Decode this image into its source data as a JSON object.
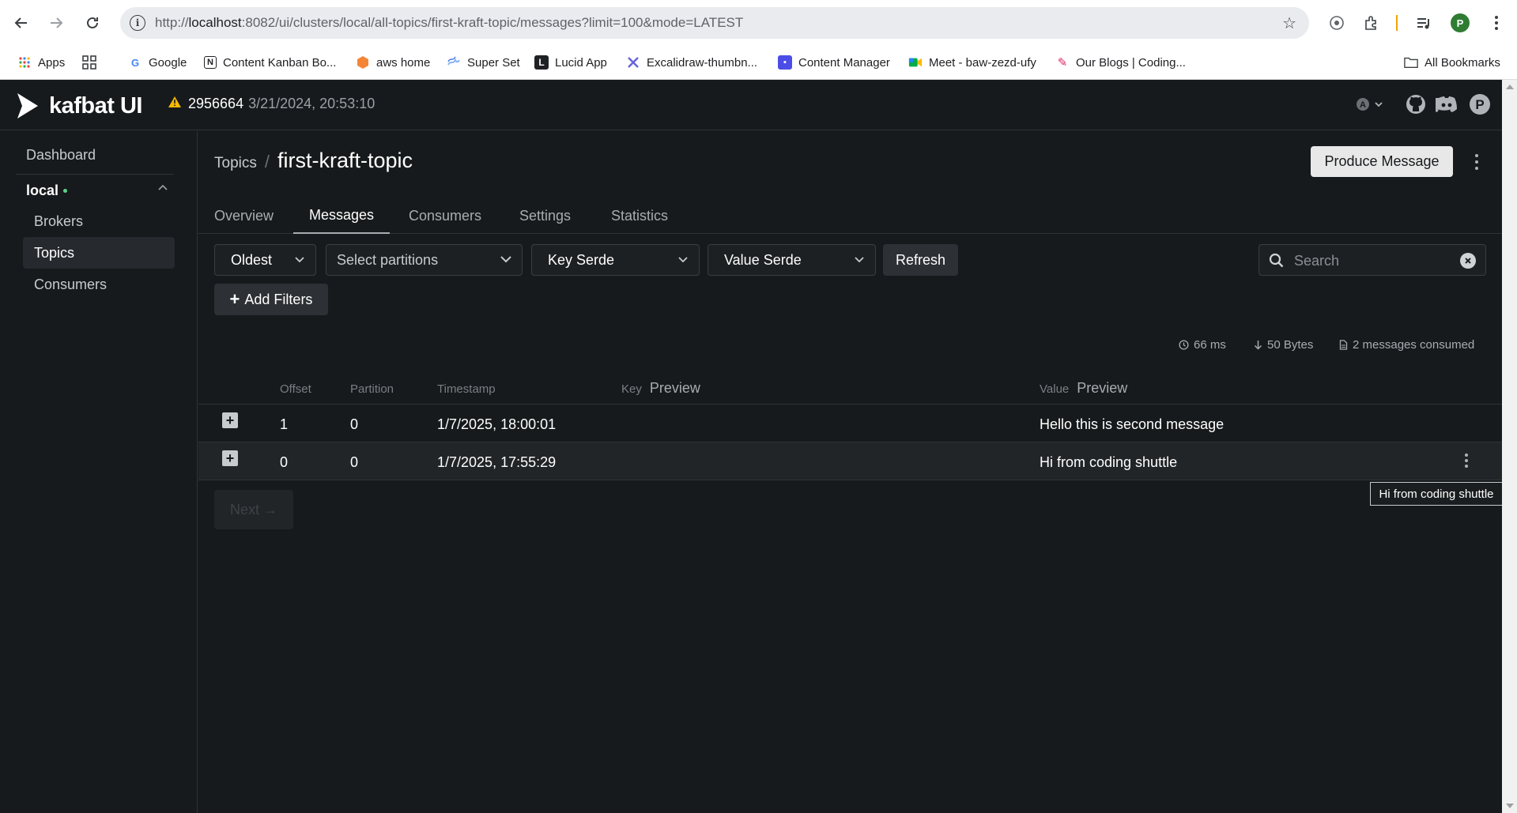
{
  "browser": {
    "url_prefix": "http://",
    "url_host": "localhost",
    "url_rest": ":8082/ui/clusters/local/all-topics/first-kraft-topic/messages?limit=100&mode=LATEST",
    "profile_initial": "P",
    "bookmarks": [
      {
        "label": "Apps",
        "icon": "apps-grid-icon"
      },
      {
        "label": "Google",
        "icon": "google-icon"
      },
      {
        "label": "Content Kanban Bo...",
        "icon": "notion-icon"
      },
      {
        "label": "aws home",
        "icon": "aws-icon"
      },
      {
        "label": "Super Set",
        "icon": "superset-icon"
      },
      {
        "label": "Lucid App",
        "icon": "lucid-icon"
      },
      {
        "label": "Excalidraw-thumbn...",
        "icon": "excalidraw-icon"
      },
      {
        "label": "Content Manager",
        "icon": "content-manager-icon"
      },
      {
        "label": "Meet - baw-zezd-ufy",
        "icon": "meet-icon"
      },
      {
        "label": "Our Blogs | Coding...",
        "icon": "blog-icon"
      }
    ],
    "all_bookmarks": "All Bookmarks"
  },
  "app": {
    "logo_text": "kafbat UI",
    "version": "2956664",
    "version_date": "3/21/2024, 20:53:10",
    "user_initial": "P"
  },
  "sidebar": {
    "dashboard": "Dashboard",
    "cluster": "local",
    "items": [
      {
        "label": "Brokers",
        "active": false
      },
      {
        "label": "Topics",
        "active": true
      },
      {
        "label": "Consumers",
        "active": false
      }
    ]
  },
  "breadcrumb": {
    "parent": "Topics",
    "separator": "/",
    "title": "first-kraft-topic"
  },
  "actions": {
    "produce": "Produce Message"
  },
  "tabs": [
    {
      "label": "Overview",
      "active": false
    },
    {
      "label": "Messages",
      "active": true
    },
    {
      "label": "Consumers",
      "active": false
    },
    {
      "label": "Settings",
      "active": false
    },
    {
      "label": "Statistics",
      "active": false
    }
  ],
  "filters": {
    "mode": "Oldest",
    "partitions_placeholder": "Select partitions",
    "key_serde": "Key Serde",
    "value_serde": "Value Serde",
    "refresh": "Refresh",
    "search_placeholder": "Search",
    "add_filters": "Add Filters"
  },
  "stats": {
    "elapsed": "66 ms",
    "bytes": "50 Bytes",
    "consumed": "2 messages consumed"
  },
  "table": {
    "headers": {
      "offset": "Offset",
      "partition": "Partition",
      "timestamp": "Timestamp",
      "key": "Key",
      "key_preview": "Preview",
      "value": "Value",
      "value_preview": "Preview"
    },
    "rows": [
      {
        "offset": "1",
        "partition": "0",
        "timestamp": "1/7/2025, 18:00:01",
        "key": "",
        "value": "Hello this is second message"
      },
      {
        "offset": "0",
        "partition": "0",
        "timestamp": "1/7/2025, 17:55:29",
        "key": "",
        "value": "Hi from coding shuttle"
      }
    ]
  },
  "pagination": {
    "next": "Next →"
  },
  "tooltip": {
    "text": "Hi from coding shuttle"
  }
}
